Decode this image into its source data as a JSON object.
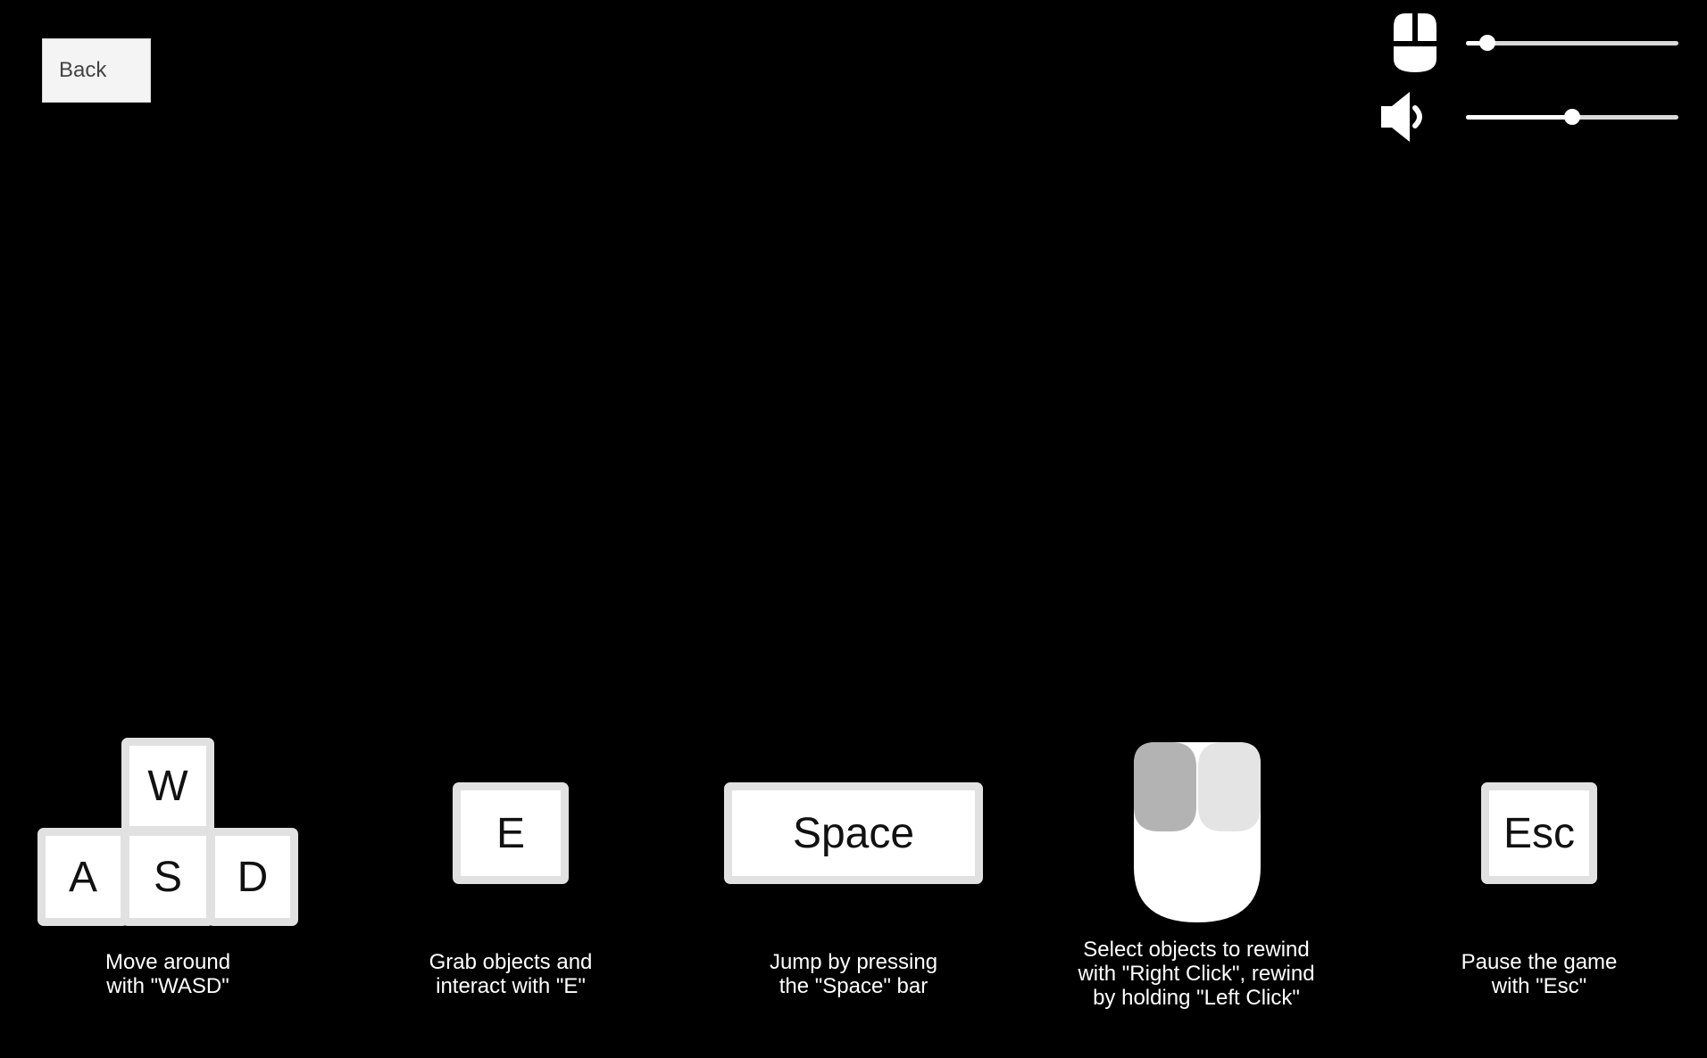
{
  "back_button": {
    "label": "Back"
  },
  "settings": {
    "mouse_sensitivity": {
      "icon": "mouse-icon",
      "value": 0.1
    },
    "volume": {
      "icon": "speaker-icon",
      "value": 0.5
    }
  },
  "controls": {
    "move": {
      "keys": {
        "w": "W",
        "a": "A",
        "s": "S",
        "d": "D"
      },
      "caption": [
        "Move around",
        "with \"WASD\""
      ]
    },
    "grab": {
      "key": "E",
      "caption": [
        "Grab objects and",
        "interact with \"E\""
      ]
    },
    "jump": {
      "key": "Space",
      "caption": [
        "Jump by pressing",
        "the \"Space\" bar"
      ]
    },
    "rewind": {
      "icon": "mouse-buttons-icon",
      "caption": [
        "Select objects to rewind",
        "with \"Right Click\", rewind",
        "by holding \"Left Click\""
      ]
    },
    "pause": {
      "key": "Esc",
      "caption": [
        "Pause the game",
        "with \"Esc\""
      ]
    }
  }
}
